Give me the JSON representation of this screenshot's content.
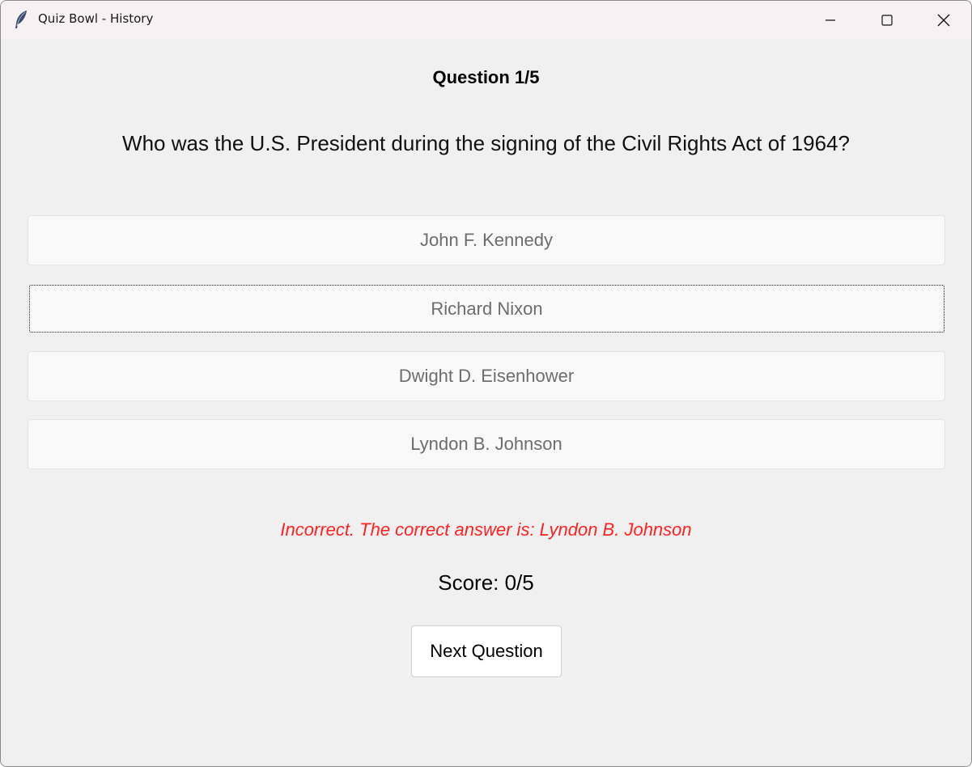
{
  "window": {
    "title": "Quiz Bowl - History",
    "app_icon": "feather-icon",
    "controls": [
      "minimize-icon",
      "maximize-icon",
      "close-icon"
    ]
  },
  "quiz": {
    "question_counter": "Question 1/5",
    "question": "Who was the U.S. President during the signing of the Civil Rights Act of 1964?",
    "options": [
      {
        "label": "John F. Kennedy",
        "focused": false
      },
      {
        "label": "Richard Nixon",
        "focused": true
      },
      {
        "label": "Dwight D. Eisenhower",
        "focused": false
      },
      {
        "label": "Lyndon B. Johnson",
        "focused": false
      }
    ],
    "feedback": "Incorrect. The correct answer is: Lyndon B. Johnson",
    "score": "Score: 0/5",
    "next_button_label": "Next Question"
  },
  "colors": {
    "feedback_text": "#ff2222",
    "window_background": "#f0f0f0",
    "option_background": "#f9f9f9",
    "option_text": "#6d6d6d"
  }
}
